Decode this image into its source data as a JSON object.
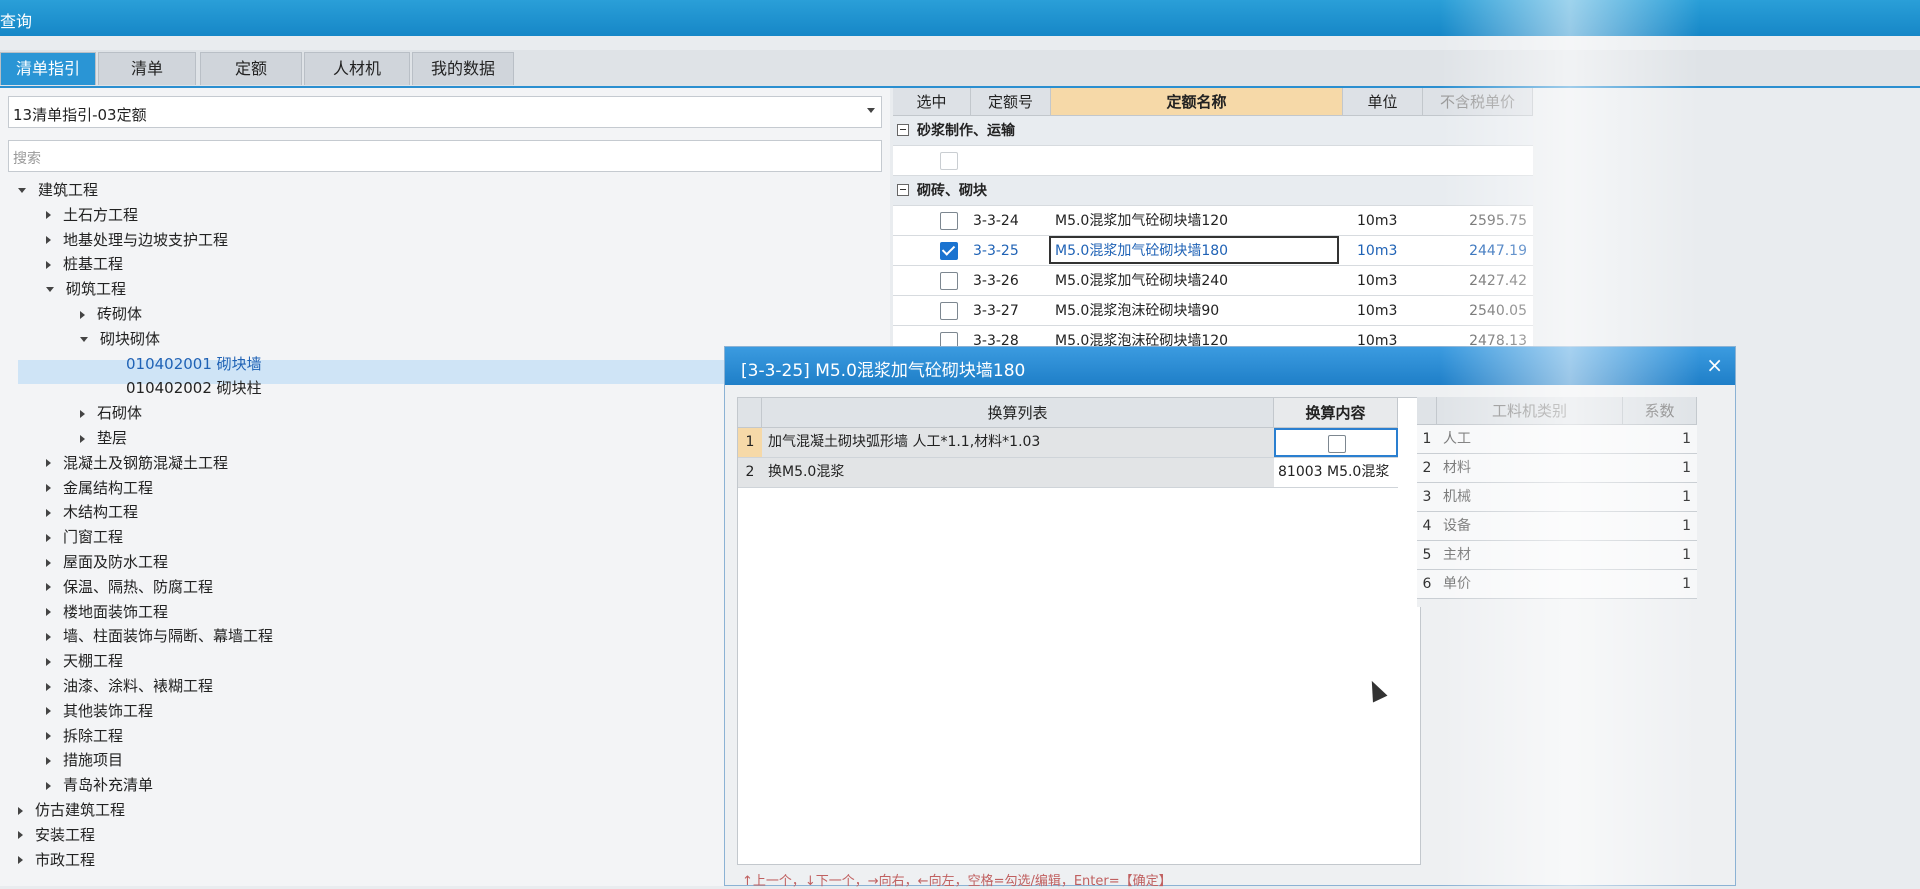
{
  "window": {
    "title": "查询"
  },
  "tabs": [
    "清单指引",
    "清单",
    "定额",
    "人材机",
    "我的数据"
  ],
  "left": {
    "selector_value": "13清单指引-03定额",
    "search_placeholder": "搜索",
    "tree": [
      {
        "label": "建筑工程",
        "depth": 0,
        "state": "open"
      },
      {
        "label": "土石方工程",
        "depth": 1,
        "state": "closed"
      },
      {
        "label": "地基处理与边坡支护工程",
        "depth": 1,
        "state": "closed"
      },
      {
        "label": "桩基工程",
        "depth": 1,
        "state": "closed"
      },
      {
        "label": "砌筑工程",
        "depth": 1,
        "state": "open"
      },
      {
        "label": "砖砌体",
        "depth": 2,
        "state": "closed"
      },
      {
        "label": "砌块砌体",
        "depth": 2,
        "state": "open"
      },
      {
        "label": "010402001  砌块墙",
        "depth": 3,
        "state": "leaf",
        "selected": true
      },
      {
        "label": "010402002  砌块柱",
        "depth": 3,
        "state": "leaf"
      },
      {
        "label": "石砌体",
        "depth": 2,
        "state": "closed"
      },
      {
        "label": "垫层",
        "depth": 2,
        "state": "closed"
      },
      {
        "label": "混凝土及钢筋混凝土工程",
        "depth": 1,
        "state": "closed"
      },
      {
        "label": "金属结构工程",
        "depth": 1,
        "state": "closed"
      },
      {
        "label": "木结构工程",
        "depth": 1,
        "state": "closed"
      },
      {
        "label": "门窗工程",
        "depth": 1,
        "state": "closed"
      },
      {
        "label": "屋面及防水工程",
        "depth": 1,
        "state": "closed"
      },
      {
        "label": "保温、隔热、防腐工程",
        "depth": 1,
        "state": "closed"
      },
      {
        "label": "楼地面装饰工程",
        "depth": 1,
        "state": "closed"
      },
      {
        "label": "墙、柱面装饰与隔断、幕墙工程",
        "depth": 1,
        "state": "closed"
      },
      {
        "label": "天棚工程",
        "depth": 1,
        "state": "closed"
      },
      {
        "label": "油漆、涂料、裱糊工程",
        "depth": 1,
        "state": "closed"
      },
      {
        "label": "其他装饰工程",
        "depth": 1,
        "state": "closed"
      },
      {
        "label": "拆除工程",
        "depth": 1,
        "state": "closed"
      },
      {
        "label": "措施项目",
        "depth": 1,
        "state": "closed"
      },
      {
        "label": "青岛补充清单",
        "depth": 1,
        "state": "closed"
      },
      {
        "label": "仿古建筑工程",
        "depth": 0,
        "state": "closed"
      },
      {
        "label": "安装工程",
        "depth": 0,
        "state": "closed"
      },
      {
        "label": "市政工程",
        "depth": 0,
        "state": "closed"
      }
    ]
  },
  "grid": {
    "headers": [
      "选中",
      "定额号",
      "定额名称",
      "单位",
      "不含税单价"
    ],
    "rows": [
      {
        "type": "group",
        "label": "砂浆制作、运输"
      },
      {
        "type": "blank"
      },
      {
        "type": "group",
        "label": "砌砖、砌块"
      },
      {
        "type": "row",
        "checked": false,
        "code": "3-3-24",
        "name": "M5.0混浆加气砼砌块墙120",
        "unit": "10m3",
        "price": "2595.75"
      },
      {
        "type": "row",
        "checked": true,
        "code": "3-3-25",
        "name": "M5.0混浆加气砼砌块墙180",
        "unit": "10m3",
        "price": "2447.19"
      },
      {
        "type": "row",
        "checked": false,
        "code": "3-3-26",
        "name": "M5.0混浆加气砼砌块墙240",
        "unit": "10m3",
        "price": "2427.42"
      },
      {
        "type": "row",
        "checked": false,
        "code": "3-3-27",
        "name": "M5.0混浆泡沫砼砌块墙90",
        "unit": "10m3",
        "price": "2540.05"
      },
      {
        "type": "row",
        "checked": false,
        "code": "3-3-28",
        "name": "M5.0混浆泡沫砼砌块墙120",
        "unit": "10m3",
        "price": "2478.13"
      }
    ]
  },
  "dialog": {
    "title": "[3-3-25] M5.0混浆加气砼砌块墙180",
    "close": "×",
    "headers": [
      "换算列表",
      "换算内容"
    ],
    "rows": [
      {
        "num": "1",
        "item": "加气混凝土砌块弧形墙 人工*1.1,材料*1.03",
        "content": "",
        "checkbox": true
      },
      {
        "num": "2",
        "item": "换M5.0混浆",
        "content": "81003  M5.0混浆",
        "checkbox": false
      }
    ],
    "side_headers": [
      "工料机类别",
      "系数"
    ],
    "side_rows": [
      {
        "num": "1",
        "name": "人工",
        "coef": "1"
      },
      {
        "num": "2",
        "name": "材料",
        "coef": "1"
      },
      {
        "num": "3",
        "name": "机械",
        "coef": "1"
      },
      {
        "num": "4",
        "name": "设备",
        "coef": "1"
      },
      {
        "num": "5",
        "name": "主材",
        "coef": "1"
      },
      {
        "num": "6",
        "name": "单价",
        "coef": "1"
      }
    ],
    "hint": "↑上一个，↓下一个，→向右，←向左，空格=勾选/编辑，Enter=【确定】"
  }
}
